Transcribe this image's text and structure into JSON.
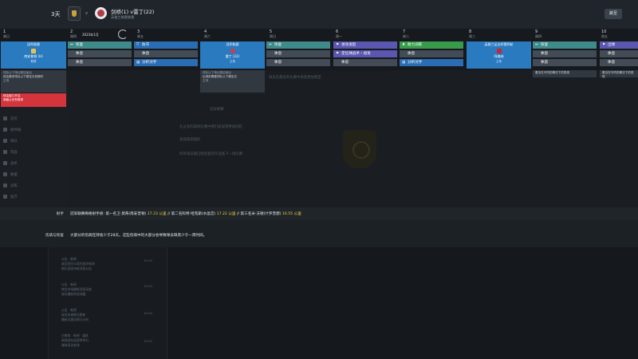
{
  "topbar": {
    "days": "3天",
    "vs": "v",
    "match": "剑桥(1) v雷丁(22)",
    "competition": "英格兰联赛联赛",
    "skip_button": "跳至"
  },
  "calendar": {
    "month_label": "2023年1月",
    "days": [
      {
        "num": "1",
        "wk": "周日"
      },
      {
        "num": "2",
        "wk": "周四"
      },
      {
        "num": "3",
        "wk": "周五"
      },
      {
        "num": "4",
        "wk": "周六"
      },
      {
        "num": "5",
        "wk": "周日"
      },
      {
        "num": "6",
        "wk": "周一"
      },
      {
        "num": "7",
        "wk": "周二"
      },
      {
        "num": "8",
        "wk": "周三"
      },
      {
        "num": "9",
        "wk": "周四"
      },
      {
        "num": "10",
        "wk": "周五"
      }
    ],
    "match_cards": [
      {
        "title": "冠军联赛",
        "name": "南安普顿 (H)",
        "comp": "联赛"
      },
      {
        "title": "冠军联赛",
        "name": "雷丁 (22)",
        "comp": "主场"
      },
      {
        "title": "英格兰足总杯第四轮",
        "name": "阿森纳",
        "comp": "主场"
      }
    ],
    "pills": {
      "recovery": "恢复",
      "rest": "休息",
      "defence": "防守",
      "analysis": "分析对手",
      "attack": "进攻发起",
      "set_pieces": "定位球战术・进攻",
      "fitness": "耐力训练",
      "match_prep": "分析对手",
      "attack2": "出球"
    }
  },
  "notes": {
    "note1_title": "球队以下场比赛结束后",
    "note1_body": "将会要求球队以下赛至去到随时",
    "note1_sub": "主场",
    "alert_title": "转会窗口开启",
    "alert_body": "离截止还有数周",
    "note2_title": "球队以下场比赛结束后",
    "note2_body": "出场前需要球队以下赛至去",
    "note2_sub": "主场",
    "ticker1": "看法在不同的情况下的表现",
    "ticker2": "看法在不同的情况下的表现"
  },
  "sidebar": {
    "items": [
      "首页",
      "收件箱",
      "球队",
      "阵容",
      "战术",
      "数据",
      "训练",
      "医疗",
      "球探"
    ]
  },
  "main_faded": {
    "heading": "冠军联赛",
    "line1": "在过去的四场比赛中我们表现得更加团结",
    "line2": "球员在最近的比赛中表现更加稳定",
    "line3": "表现越来越好",
    "line4": "比赛之中表现出色",
    "line5": "所有球员都已经恢复完毕准备下一场比赛"
  },
  "info": {
    "scorers_label": "射手",
    "scorers_text_a": "冠军联赛梅格射手榜: 第一名卫·莫蒂(南安普顿)",
    "scorers_goal_a": "17.23 公里",
    "scorers_text_b": "// 第二名科特·哈克斯(水晶宫)",
    "scorers_goal_b": "17.22 公里",
    "scorers_text_c": "// 第三名米·沃德(什罗普郡)",
    "scorers_goal_c": "16.55 公里",
    "injury_label": "伤病与恢复",
    "injury_text": "大部分的伤病在持续少于28天。这些伤病中的大部分会导致球员缺席少于一周时间。"
  },
  "feed": {
    "entries": [
      {
        "title": "公告 · 新闻",
        "body1": "球员签约与续约相关新闻",
        "body2": "俱乐部发布新消息公告",
        "time": "19:00"
      },
      {
        "title": "公告 · 新闻",
        "body1": "转会市场最新消息动态",
        "body2": "球队最新阵容调整",
        "time": "18:50"
      },
      {
        "title": "公告 · 新闻",
        "body1": "球员伤病情况更新",
        "body2": "最新比赛回顾与分析",
        "time": "18:00"
      },
      {
        "title": "主教练 · 新闻 · 媒体",
        "body1": "新闻发布会即将举行",
        "body2": "媒体采访安排",
        "time": "16:55"
      }
    ]
  },
  "colors": {
    "card_blue": "#2a7ac0",
    "alert_red": "#d4343c",
    "highlight_yellow": "#f0d23c"
  }
}
